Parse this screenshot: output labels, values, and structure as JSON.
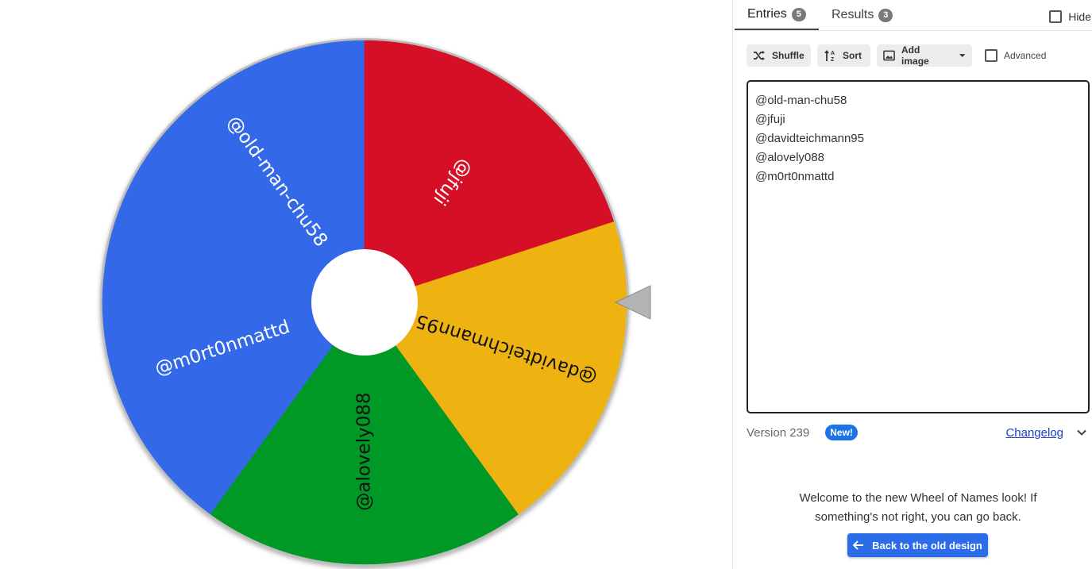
{
  "wheel": {
    "center_label": "",
    "slices": [
      {
        "label": "@old-man-chu58",
        "color": "#3369e8"
      },
      {
        "label": "@m0rt0nmattd",
        "color": "#3369e8"
      },
      {
        "label": "@alovely088",
        "color": "#009925"
      },
      {
        "label": "@davidteichmann95",
        "color": "#eeb211"
      },
      {
        "label": "@jfuji",
        "color": "#d50f25"
      }
    ]
  },
  "tabs": {
    "entries_label": "Entries",
    "entries_count": "5",
    "results_label": "Results",
    "results_count": "3"
  },
  "hide_label": "Hide",
  "toolbar": {
    "shuffle_label": "Shuffle",
    "sort_label": "Sort",
    "add_image_label": "Add image",
    "advanced_label": "Advanced"
  },
  "entries": [
    "@old-man-chu58",
    "@jfuji",
    "@davidteichmann95",
    "@alovely088",
    "@m0rt0nmattd"
  ],
  "version": {
    "label": "Version 239",
    "new_badge": "New!",
    "changelog_label": "Changelog"
  },
  "welcome": {
    "line1": "Welcome to the new Wheel of Names look! If",
    "line2": "something's not right, you can go back."
  },
  "back_button_label": "Back to the old design",
  "colors": {
    "blue": "#3369e8",
    "green": "#009925",
    "yellow": "#eeb211",
    "red": "#d50f25",
    "accent": "#2b6de8"
  }
}
